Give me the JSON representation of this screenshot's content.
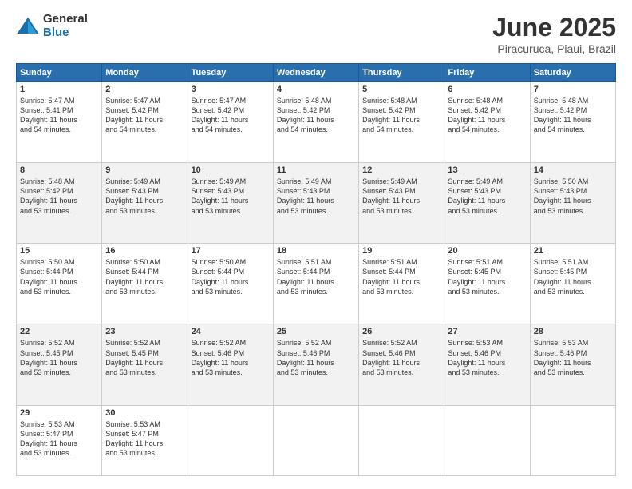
{
  "header": {
    "logo_general": "General",
    "logo_blue": "Blue",
    "title": "June 2025",
    "location": "Piracuruca, Piaui, Brazil"
  },
  "weekdays": [
    "Sunday",
    "Monday",
    "Tuesday",
    "Wednesday",
    "Thursday",
    "Friday",
    "Saturday"
  ],
  "weeks": [
    [
      {
        "day": "1",
        "sunrise": "5:47 AM",
        "sunset": "5:41 PM",
        "daylight": "11 hours and 54 minutes."
      },
      {
        "day": "2",
        "sunrise": "5:47 AM",
        "sunset": "5:42 PM",
        "daylight": "11 hours and 54 minutes."
      },
      {
        "day": "3",
        "sunrise": "5:47 AM",
        "sunset": "5:42 PM",
        "daylight": "11 hours and 54 minutes."
      },
      {
        "day": "4",
        "sunrise": "5:48 AM",
        "sunset": "5:42 PM",
        "daylight": "11 hours and 54 minutes."
      },
      {
        "day": "5",
        "sunrise": "5:48 AM",
        "sunset": "5:42 PM",
        "daylight": "11 hours and 54 minutes."
      },
      {
        "day": "6",
        "sunrise": "5:48 AM",
        "sunset": "5:42 PM",
        "daylight": "11 hours and 54 minutes."
      },
      {
        "day": "7",
        "sunrise": "5:48 AM",
        "sunset": "5:42 PM",
        "daylight": "11 hours and 54 minutes."
      }
    ],
    [
      {
        "day": "8",
        "sunrise": "5:48 AM",
        "sunset": "5:42 PM",
        "daylight": "11 hours and 53 minutes."
      },
      {
        "day": "9",
        "sunrise": "5:49 AM",
        "sunset": "5:43 PM",
        "daylight": "11 hours and 53 minutes."
      },
      {
        "day": "10",
        "sunrise": "5:49 AM",
        "sunset": "5:43 PM",
        "daylight": "11 hours and 53 minutes."
      },
      {
        "day": "11",
        "sunrise": "5:49 AM",
        "sunset": "5:43 PM",
        "daylight": "11 hours and 53 minutes."
      },
      {
        "day": "12",
        "sunrise": "5:49 AM",
        "sunset": "5:43 PM",
        "daylight": "11 hours and 53 minutes."
      },
      {
        "day": "13",
        "sunrise": "5:49 AM",
        "sunset": "5:43 PM",
        "daylight": "11 hours and 53 minutes."
      },
      {
        "day": "14",
        "sunrise": "5:50 AM",
        "sunset": "5:43 PM",
        "daylight": "11 hours and 53 minutes."
      }
    ],
    [
      {
        "day": "15",
        "sunrise": "5:50 AM",
        "sunset": "5:44 PM",
        "daylight": "11 hours and 53 minutes."
      },
      {
        "day": "16",
        "sunrise": "5:50 AM",
        "sunset": "5:44 PM",
        "daylight": "11 hours and 53 minutes."
      },
      {
        "day": "17",
        "sunrise": "5:50 AM",
        "sunset": "5:44 PM",
        "daylight": "11 hours and 53 minutes."
      },
      {
        "day": "18",
        "sunrise": "5:51 AM",
        "sunset": "5:44 PM",
        "daylight": "11 hours and 53 minutes."
      },
      {
        "day": "19",
        "sunrise": "5:51 AM",
        "sunset": "5:44 PM",
        "daylight": "11 hours and 53 minutes."
      },
      {
        "day": "20",
        "sunrise": "5:51 AM",
        "sunset": "5:45 PM",
        "daylight": "11 hours and 53 minutes."
      },
      {
        "day": "21",
        "sunrise": "5:51 AM",
        "sunset": "5:45 PM",
        "daylight": "11 hours and 53 minutes."
      }
    ],
    [
      {
        "day": "22",
        "sunrise": "5:52 AM",
        "sunset": "5:45 PM",
        "daylight": "11 hours and 53 minutes."
      },
      {
        "day": "23",
        "sunrise": "5:52 AM",
        "sunset": "5:45 PM",
        "daylight": "11 hours and 53 minutes."
      },
      {
        "day": "24",
        "sunrise": "5:52 AM",
        "sunset": "5:46 PM",
        "daylight": "11 hours and 53 minutes."
      },
      {
        "day": "25",
        "sunrise": "5:52 AM",
        "sunset": "5:46 PM",
        "daylight": "11 hours and 53 minutes."
      },
      {
        "day": "26",
        "sunrise": "5:52 AM",
        "sunset": "5:46 PM",
        "daylight": "11 hours and 53 minutes."
      },
      {
        "day": "27",
        "sunrise": "5:53 AM",
        "sunset": "5:46 PM",
        "daylight": "11 hours and 53 minutes."
      },
      {
        "day": "28",
        "sunrise": "5:53 AM",
        "sunset": "5:46 PM",
        "daylight": "11 hours and 53 minutes."
      }
    ],
    [
      {
        "day": "29",
        "sunrise": "5:53 AM",
        "sunset": "5:47 PM",
        "daylight": "11 hours and 53 minutes."
      },
      {
        "day": "30",
        "sunrise": "5:53 AM",
        "sunset": "5:47 PM",
        "daylight": "11 hours and 53 minutes."
      },
      null,
      null,
      null,
      null,
      null
    ]
  ],
  "labels": {
    "sunrise": "Sunrise:",
    "sunset": "Sunset:",
    "daylight": "Daylight:"
  }
}
